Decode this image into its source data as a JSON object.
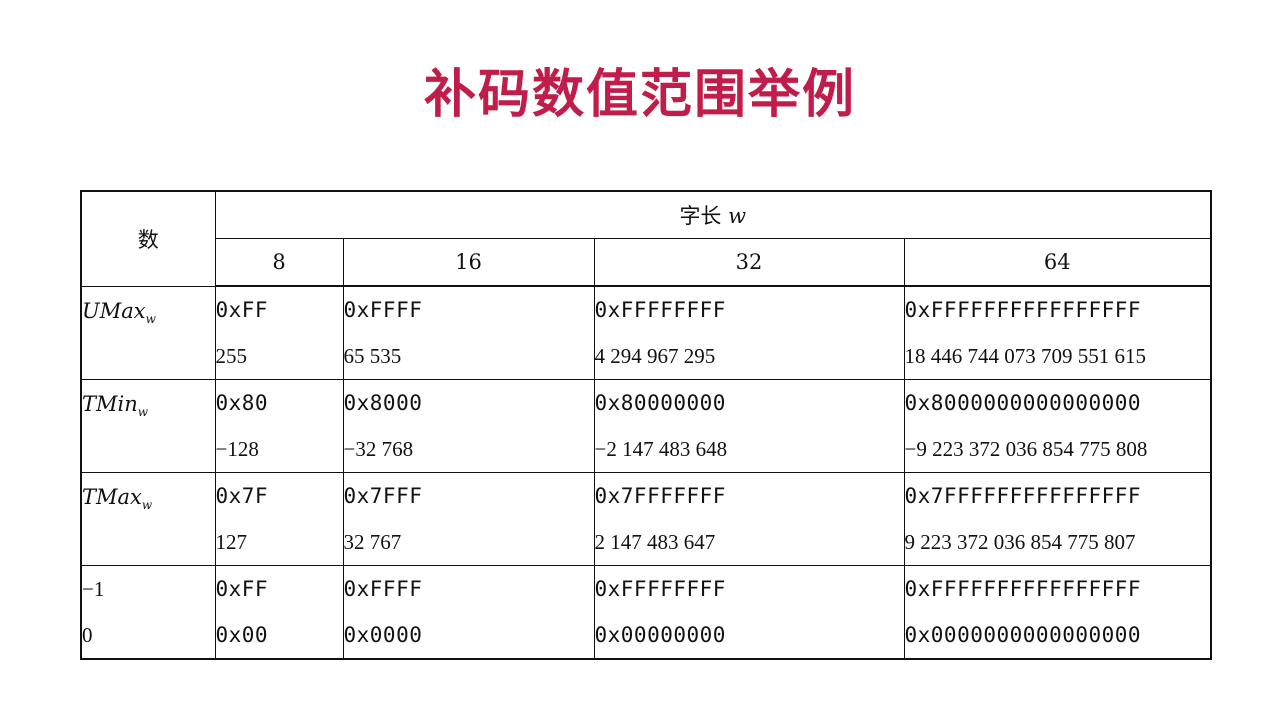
{
  "title": "补码数值范围举例",
  "table": {
    "number_header": "数",
    "word_size_header": "字长",
    "word_size_var": "w",
    "columns": [
      "8",
      "16",
      "32",
      "64"
    ],
    "groups": [
      {
        "label_main": "UMax",
        "label_sub": "w",
        "rows": [
          [
            "0xFF",
            "0xFFFF",
            "0xFFFFFFFF",
            "0xFFFFFFFFFFFFFFFF"
          ],
          [
            "255",
            "65 535",
            "4 294 967 295",
            "18 446 744 073 709 551 615"
          ]
        ]
      },
      {
        "label_main": "TMin",
        "label_sub": "w",
        "rows": [
          [
            "0x80",
            "0x8000",
            "0x80000000",
            "0x8000000000000000"
          ],
          [
            "−128",
            "−32 768",
            "−2 147 483 648",
            "−9 223 372 036 854 775 808"
          ]
        ]
      },
      {
        "label_main": "TMax",
        "label_sub": "w",
        "rows": [
          [
            "0x7F",
            "0x7FFF",
            "0x7FFFFFFF",
            "0x7FFFFFFFFFFFFFFF"
          ],
          [
            "127",
            "32 767",
            "2 147 483 647",
            "9 223 372 036 854 775 807"
          ]
        ]
      },
      {
        "labels": [
          "−1",
          "0"
        ],
        "rows": [
          [
            "0xFF",
            "0xFFFF",
            "0xFFFFFFFF",
            "0xFFFFFFFFFFFFFFFF"
          ],
          [
            "0x00",
            "0x0000",
            "0x00000000",
            "0x0000000000000000"
          ]
        ]
      }
    ]
  }
}
